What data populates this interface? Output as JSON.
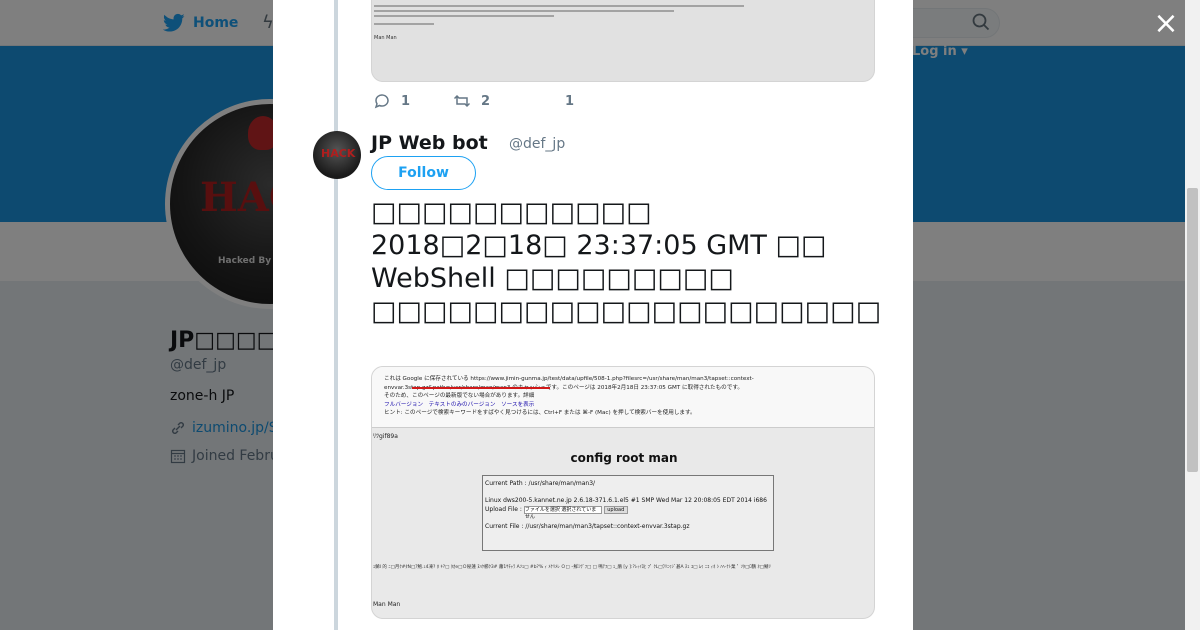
{
  "nav": {
    "home_label": "Home",
    "login_label": "Log in ▾"
  },
  "profile": {
    "name": "JPの無名の Web bot",
    "name_visible": "JP□□□□ W",
    "handle": "@def_jp",
    "bio": "zone-h JP",
    "link": "izumino.jp/S",
    "joined": "Joined Febru"
  },
  "modal": {
    "close_label": "×",
    "prev_tweet": {
      "reply_count": "1",
      "retweet_count": "2",
      "like_count": "1"
    },
    "tweet": {
      "display_name": "JP Web bot",
      "handle": "@def_jp",
      "follow_label": "Follow",
      "text_lines": [
        "□□□□□□□□□□□",
        "",
        "2018□2□18□ 23:37:05 GMT □□",
        "WebShell □□□□□□□□□",
        "□□□□□□□□□□□□□□□□□□□□"
      ],
      "media": {
        "cache_line1": "これは Google に保存されている https://www.jimin-gunma.jp/test/data/upfile/508-1.php?filesrc=/usr/share/man/man3/tapset::context-envvar.3stap.gz&path=/usr/share/man/man3 のキャッシュです。このページは 2018年2月18日 23:37:05 GMT に取得されたものです。",
        "cache_line2": "そのため、このページの最新版でない場合があります。詳細",
        "cache_tabs": "フルバージョン　テキストのみのバージョン　ソースを表示",
        "cache_hint": "ヒント: このページで検索キーワードをすばやく見つけるには、Ctrl+F または ⌘-F (Mac) を押して検索バーを使用します。",
        "gif_label": "ﾘﾂgif89a",
        "title": "config root man",
        "current_path": "Current Path : /usr/share/man/man3/",
        "system_info": "Linux dws200-5.kannet.ne.jp 2.6.18-371.6.1.el5 #1 SMP Wed Mar 12 20:08:05 EDT 2014 i686",
        "upload_label": "Upload File :",
        "file_input": "ファイルを選択  選択されていません",
        "upload_button": "upload",
        "current_file": "Current File : //usr/share/man/man3/tapset::context-envvar.3stap.gz",
        "garble": "ｪ鯑l 的 ﾆ□月ｸ#ﾀN□ｱ鮑.ｭ4凍? ﾎ ｷ?□ ﾀｶe□Ｏ秘蓮 ﾇﾊｹ櫛ｸ3# 蕭1ｻﾁｬﾗ Aｿｪ□ #b?% ｨ ﾒｹﾘﾒﾚ Ｏ□ ｰ鮮ﾐｳﾞﾌ□ □ 鳴ﾃﾌ□ ｪ_鵑 [y ]:?ﾚｨｲﾛﾋ ﾌﾟ ｸL□ﾜﾘﾆｩｼﾞ碁A ﾇｪ ﾕ□ ﾑｩ ﾆｺ ｨﾈ ｼ ﾊﾍ-ﾅﾄ業 ﾟ ｿﾀ□ﾛ鶴 ﾈ□鯖ﾘ",
        "footer": "Man Man"
      }
    }
  }
}
